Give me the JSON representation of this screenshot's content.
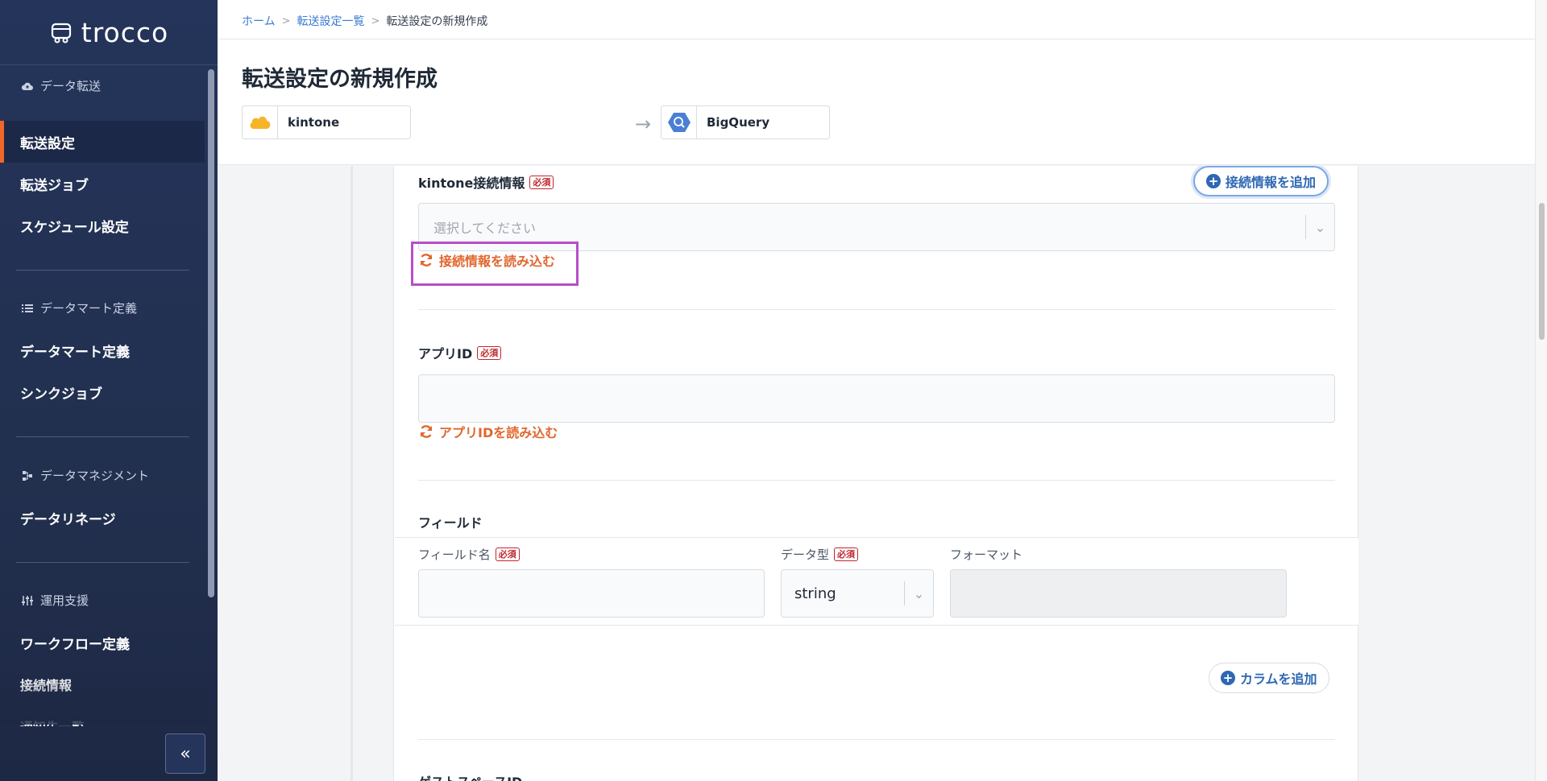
{
  "app": {
    "logo_text": "trocco"
  },
  "sidebar": {
    "sections": [
      {
        "heading": "データ転送",
        "icon": "cloud-upload-icon"
      },
      {
        "heading": "データマート定義",
        "icon": "list-icon"
      },
      {
        "heading": "データマネジメント",
        "icon": "lineage-icon"
      },
      {
        "heading": "運用支援",
        "icon": "sliders-icon"
      }
    ],
    "items": [
      {
        "label": "転送設定",
        "active": true
      },
      {
        "label": "転送ジョブ"
      },
      {
        "label": "スケジュール設定"
      },
      {
        "label": "データマート定義"
      },
      {
        "label": "シンクジョブ"
      },
      {
        "label": "データリネージ"
      },
      {
        "label": "ワークフロー定義"
      },
      {
        "label": "接続情報"
      },
      {
        "label": "通知先一覧"
      }
    ],
    "collapse_label": "«"
  },
  "header": {
    "breadcrumb": [
      "ホーム",
      "転送設定一覧",
      "転送設定の新規作成"
    ],
    "title": "転送設定の新規作成",
    "source": {
      "name": "kintone",
      "icon": "kintone-icon",
      "color": "#f6b526"
    },
    "destination": {
      "name": "BigQuery",
      "icon": "bigquery-icon",
      "color": "#4a7fd4"
    }
  },
  "form": {
    "connection": {
      "label": "kintone接続情報",
      "required": "必須",
      "placeholder": "選択してください",
      "add_button": "接続情報を追加",
      "reload_button": "接続情報を読み込む"
    },
    "app_id": {
      "label": "アプリID",
      "required": "必須",
      "value": "",
      "reload_button": "アプリIDを読み込む"
    },
    "fields": {
      "label": "フィールド",
      "columns": [
        {
          "label": "フィールド名",
          "required": "必須"
        },
        {
          "label": "データ型",
          "required": "必須"
        },
        {
          "label": "フォーマット"
        }
      ],
      "row": {
        "name": "",
        "type": "string",
        "format": ""
      },
      "add_column_button": "カラムを追加"
    },
    "guest_space": {
      "label": "ゲストスペースID"
    }
  },
  "colors": {
    "accent": "#f0672b",
    "link": "#3b7bd1",
    "reload": "#e0672f",
    "highlight": "#b84dc9",
    "sidebar_bg": "#24345a",
    "primary_button": "#2e68b3"
  }
}
